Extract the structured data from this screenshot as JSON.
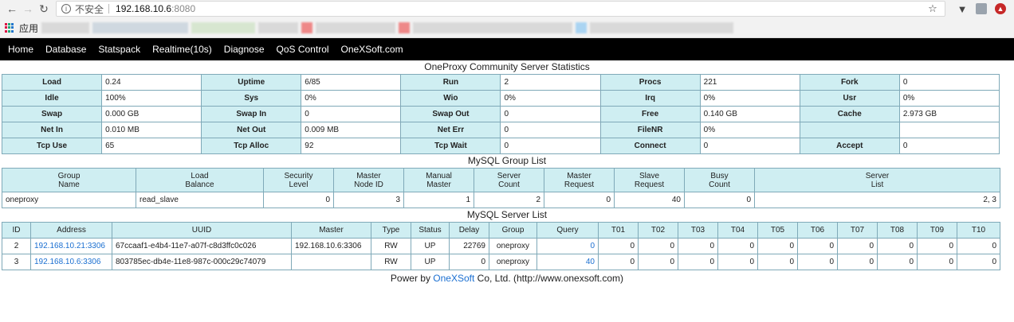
{
  "browser": {
    "insecure_label": "不安全",
    "url_host": "192.168.10.6",
    "url_port": ":8080",
    "apps_label": "应用"
  },
  "menu": [
    "Home",
    "Database",
    "Statspack",
    "Realtime(10s)",
    "Diagnose",
    "QoS Control",
    "OneXSoft.com"
  ],
  "stats": {
    "title": "OneProxy Community Server Statistics",
    "rows": [
      [
        [
          "Load",
          "0.24"
        ],
        [
          "Uptime",
          "6/85"
        ],
        [
          "Run",
          "2"
        ],
        [
          "Procs",
          "221"
        ],
        [
          "Fork",
          "0"
        ]
      ],
      [
        [
          "Idle",
          "100%"
        ],
        [
          "Sys",
          "0%"
        ],
        [
          "Wio",
          "0%"
        ],
        [
          "Irq",
          "0%"
        ],
        [
          "Usr",
          "0%"
        ]
      ],
      [
        [
          "Swap",
          "0.000 GB"
        ],
        [
          "Swap In",
          "0"
        ],
        [
          "Swap Out",
          "0"
        ],
        [
          "Free",
          "0.140 GB"
        ],
        [
          "Cache",
          "2.973 GB"
        ]
      ],
      [
        [
          "Net In",
          "0.010 MB"
        ],
        [
          "Net Out",
          "0.009 MB"
        ],
        [
          "Net Err",
          "0"
        ],
        [
          "FileNR",
          "0%"
        ],
        [
          "",
          ""
        ]
      ],
      [
        [
          "Tcp Use",
          "65"
        ],
        [
          "Tcp Alloc",
          "92"
        ],
        [
          "Tcp Wait",
          "0"
        ],
        [
          "Connect",
          "0"
        ],
        [
          "Accept",
          "0"
        ]
      ]
    ]
  },
  "group_list": {
    "title": "MySQL Group List",
    "headers": [
      [
        "Group",
        "Name"
      ],
      [
        "Load",
        "Balance"
      ],
      [
        "Security",
        "Level"
      ],
      [
        "Master",
        "Node ID"
      ],
      [
        "Manual",
        "Master"
      ],
      [
        "Server",
        "Count"
      ],
      [
        "Master",
        "Request"
      ],
      [
        "Slave",
        "Request"
      ],
      [
        "Busy",
        "Count"
      ],
      [
        "Server",
        "List"
      ]
    ],
    "rows": [
      [
        "oneproxy",
        "read_slave",
        "0",
        "3",
        "1",
        "2",
        "0",
        "40",
        "0",
        "2, 3"
      ]
    ]
  },
  "server_list": {
    "title": "MySQL Server List",
    "headers": [
      "ID",
      "Address",
      "UUID",
      "Master",
      "Type",
      "Status",
      "Delay",
      "Group",
      "Query",
      "T01",
      "T02",
      "T03",
      "T04",
      "T05",
      "T06",
      "T07",
      "T08",
      "T09",
      "T10"
    ],
    "rows": [
      [
        "2",
        "192.168.10.21:3306",
        "67ccaaf1-e4b4-11e7-a07f-c8d3ffc0c026",
        "192.168.10.6:3306",
        "RW",
        "UP",
        "22769",
        "oneproxy",
        "0",
        "0",
        "0",
        "0",
        "0",
        "0",
        "0",
        "0",
        "0",
        "0",
        "0"
      ],
      [
        "3",
        "192.168.10.6:3306",
        "803785ec-db4e-11e8-987c-000c29c74079",
        "",
        "RW",
        "UP",
        "0",
        "oneproxy",
        "40",
        "0",
        "0",
        "0",
        "0",
        "0",
        "0",
        "0",
        "0",
        "0",
        "0"
      ]
    ]
  },
  "footer": {
    "prefix": "Power by ",
    "brand": "OneXSoft",
    "suffix": " Co, Ltd. (http://www.onexsoft.com)"
  },
  "colors": {
    "header_bg": "#cfeef2",
    "link": "#1a6fd1",
    "menubar": "#000000"
  }
}
